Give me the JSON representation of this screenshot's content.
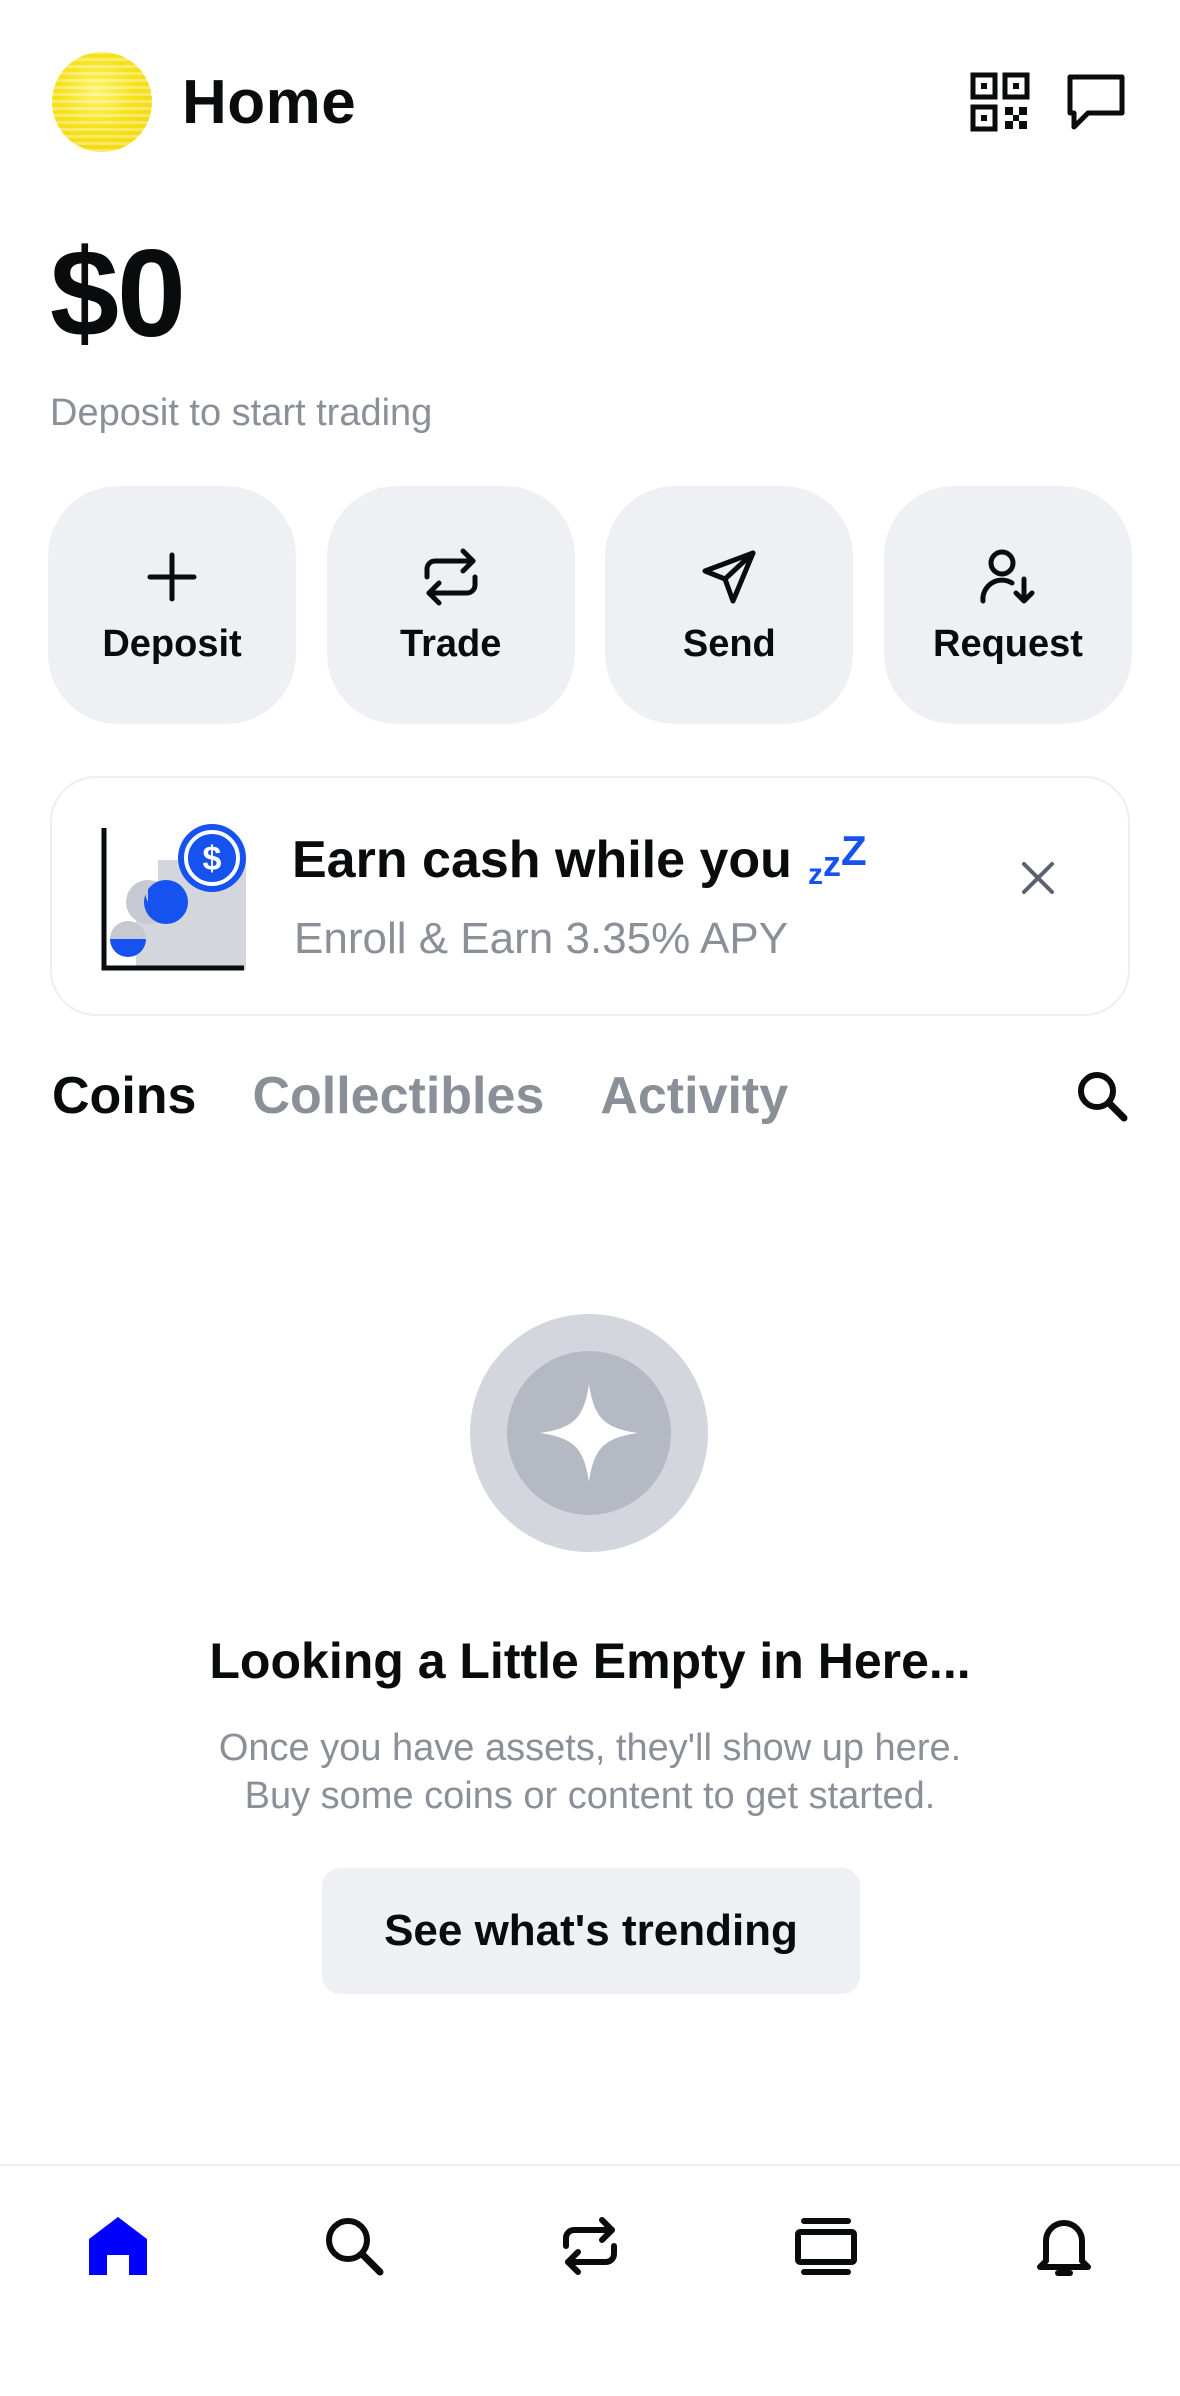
{
  "header": {
    "title": "Home",
    "avatar_icon": "yellow-coin-avatar",
    "qr_icon": "qr-code-icon",
    "messages_icon": "chat-bubble-icon"
  },
  "balance": {
    "amount": "$0",
    "subtitle": "Deposit to start trading"
  },
  "actions": [
    {
      "label": "Deposit",
      "icon": "plus-icon"
    },
    {
      "label": "Trade",
      "icon": "swap-arrows-icon"
    },
    {
      "label": "Send",
      "icon": "paper-plane-icon"
    },
    {
      "label": "Request",
      "icon": "user-arrow-down-icon"
    }
  ],
  "promo": {
    "title": "Earn cash while you",
    "zzz": [
      "z",
      "z",
      "Z"
    ],
    "subtitle": "Enroll & Earn 3.35% APY",
    "illustration_icon": "usdc-growth-chart-icon",
    "close_icon": "close-icon"
  },
  "tabs": [
    {
      "label": "Coins",
      "active": true
    },
    {
      "label": "Collectibles",
      "active": false
    },
    {
      "label": "Activity",
      "active": false
    }
  ],
  "tabs_search_icon": "search-icon",
  "empty_state": {
    "icon": "sparkle-icon",
    "title": "Looking a Little Empty in Here...",
    "line1": "Once you have assets, they'll show up here.",
    "line2": "Buy some coins or content to get started.",
    "button_label": "See what's trending"
  },
  "bottom_nav": [
    {
      "name": "home",
      "icon": "home-icon",
      "active": true
    },
    {
      "name": "explore",
      "icon": "search-icon",
      "active": false
    },
    {
      "name": "trade",
      "icon": "swap-arrows-icon",
      "active": false
    },
    {
      "name": "collections",
      "icon": "stack-icon",
      "active": false
    },
    {
      "name": "notifications",
      "icon": "bell-icon",
      "active": false
    }
  ],
  "colors": {
    "accent": "#1652f0",
    "nav_active": "#0000ff",
    "text_primary": "#0a0b0d",
    "text_secondary": "#8a8f98",
    "button_bg": "#eef0f3"
  }
}
